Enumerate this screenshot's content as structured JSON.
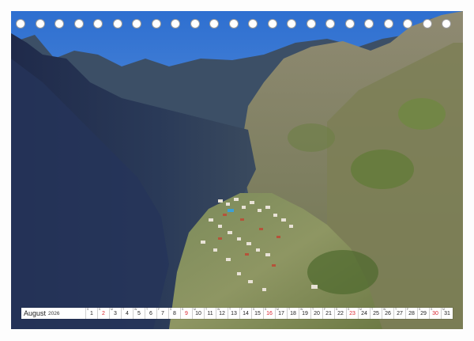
{
  "calendar": {
    "month": "August",
    "year": "2026",
    "weekdays": [
      "S",
      "S",
      "M",
      "T",
      "W",
      "T",
      "F",
      "S",
      "S",
      "M",
      "T",
      "W",
      "T",
      "F",
      "S",
      "S",
      "M",
      "T",
      "W",
      "T",
      "F",
      "S",
      "S",
      "M",
      "T",
      "W",
      "T",
      "F",
      "S",
      "S",
      "M"
    ],
    "days": [
      "1",
      "2",
      "3",
      "4",
      "5",
      "6",
      "7",
      "8",
      "9",
      "10",
      "11",
      "12",
      "13",
      "14",
      "15",
      "16",
      "17",
      "18",
      "19",
      "20",
      "21",
      "22",
      "23",
      "24",
      "25",
      "26",
      "27",
      "28",
      "29",
      "30",
      "31"
    ],
    "red_days": [
      2,
      9,
      16,
      23,
      30
    ],
    "holiday_color": "#d9252f"
  },
  "photo": {
    "subject": "mountain-valley-village"
  },
  "binding": {
    "hole_count": 23
  }
}
